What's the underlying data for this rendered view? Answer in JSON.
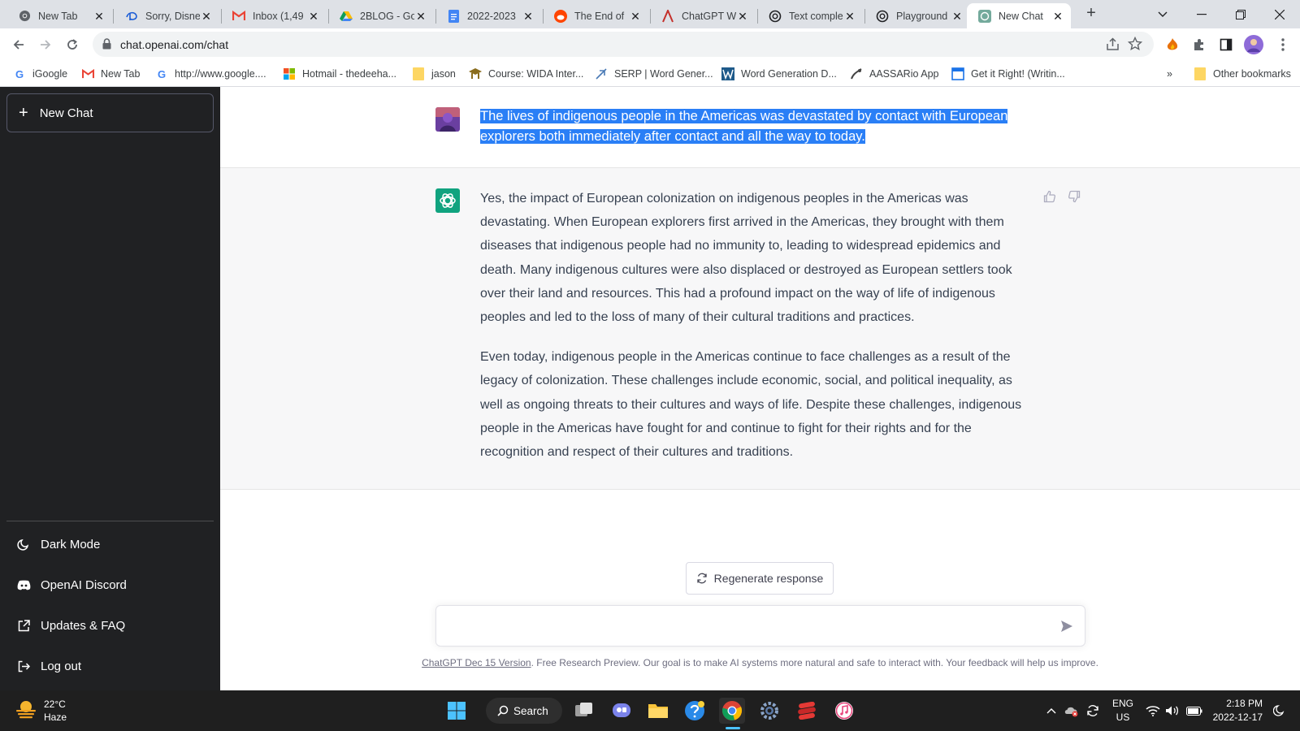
{
  "browser": {
    "tabs": [
      {
        "title": "New Tab",
        "icon": "chrome-icon"
      },
      {
        "title": "Sorry, Disne",
        "icon": "disney-icon"
      },
      {
        "title": "Inbox (1,49",
        "icon": "gmail-icon"
      },
      {
        "title": "2BLOG - Go",
        "icon": "google-drive-icon"
      },
      {
        "title": "2022-2023",
        "icon": "google-docs-icon"
      },
      {
        "title": "The End of",
        "icon": "reddit-icon"
      },
      {
        "title": "ChatGPT W",
        "icon": "article-icon"
      },
      {
        "title": "Text comple",
        "icon": "openai-icon"
      },
      {
        "title": "Playground",
        "icon": "openai-icon"
      },
      {
        "title": "New Chat",
        "icon": "chatgpt-icon"
      }
    ],
    "url": "chat.openai.com/chat",
    "bookmarks": [
      {
        "label": "iGoogle"
      },
      {
        "label": "New Tab"
      },
      {
        "label": "http://www.google...."
      },
      {
        "label": "Hotmail - thedeeha..."
      },
      {
        "label": "jason"
      },
      {
        "label": "Course: WIDA Inter..."
      },
      {
        "label": "SERP | Word Gener..."
      },
      {
        "label": "Word Generation D..."
      },
      {
        "label": "AASSARio App"
      },
      {
        "label": "Get it Right! (Writin..."
      }
    ],
    "more_bookmarks": "»",
    "other_bookmarks": "Other bookmarks"
  },
  "sidebar": {
    "new_chat": "New Chat",
    "items": [
      {
        "label": "Dark Mode",
        "icon": "moon-icon"
      },
      {
        "label": "OpenAI Discord",
        "icon": "discord-icon"
      },
      {
        "label": "Updates & FAQ",
        "icon": "external-link-icon"
      },
      {
        "label": "Log out",
        "icon": "logout-icon"
      }
    ]
  },
  "chat": {
    "user_message": "The lives of indigenous people in the Americas was devastated by contact with European explorers both immediately after contact and all the way to today.",
    "assistant_paragraphs": [
      "Yes, the impact of European colonization on indigenous peoples in the Americas was devastating. When European explorers first arrived in the Americas, they brought with them diseases that indigenous people had no immunity to, leading to widespread epidemics and death. Many indigenous cultures were also displaced or destroyed as European settlers took over their land and resources. This had a profound impact on the way of life of indigenous peoples and led to the loss of many of their cultural traditions and practices.",
      "Even today, indigenous people in the Americas continue to face challenges as a result of the legacy of colonization. These challenges include economic, social, and political inequality, as well as ongoing threats to their cultures and ways of life. Despite these challenges, indigenous people in the Americas have fought for and continue to fight for their rights and for the recognition and respect of their cultures and traditions."
    ],
    "regenerate": "Regenerate response",
    "input_value": "",
    "footer_link": "ChatGPT Dec 15 Version",
    "footer_text": ". Free Research Preview. Our goal is to make AI systems more natural and safe to interact with. Your feedback will help us improve."
  },
  "taskbar": {
    "temperature": "22°C",
    "condition": "Haze",
    "search": "Search",
    "lang_top": "ENG",
    "lang_bottom": "US",
    "time": "2:18 PM",
    "date": "2022-12-17"
  },
  "colors": {
    "sidebar_bg": "#202123",
    "accent": "#10a37f",
    "selection": "#2a7ff6"
  }
}
